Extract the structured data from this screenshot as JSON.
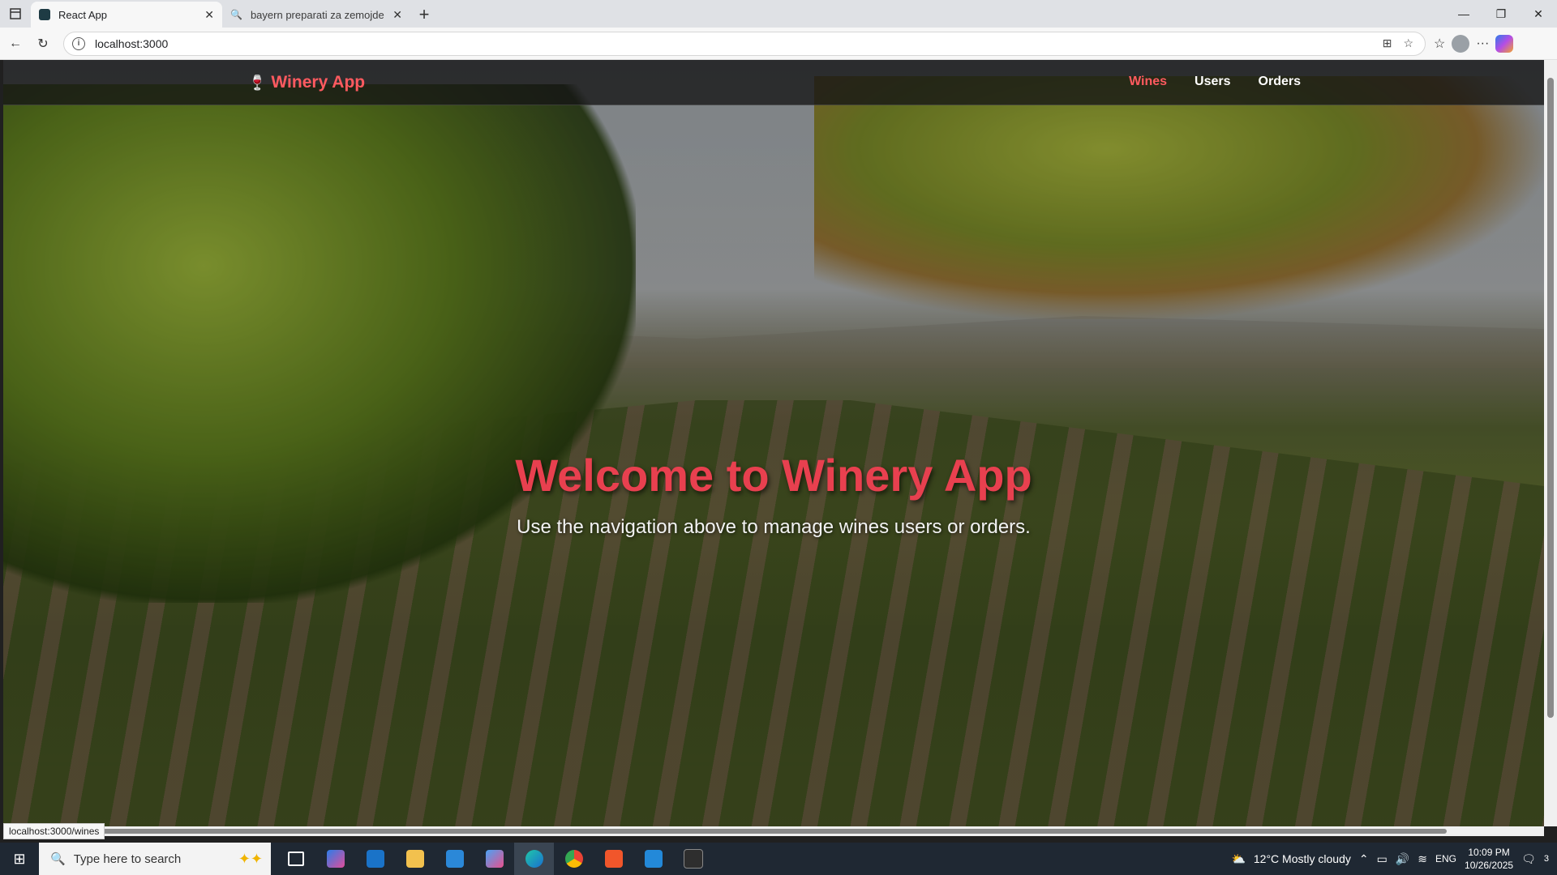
{
  "browser": {
    "tabs": [
      {
        "title": "React App",
        "active": true
      },
      {
        "title": "bayern preparati za zemojdelstvo",
        "active": false
      }
    ],
    "url": "localhost:3000",
    "status_url": "localhost:3000/wines"
  },
  "app": {
    "brand": "Winery App",
    "brand_icon": "wine-glass-icon",
    "nav": [
      {
        "label": "Wines",
        "active": true
      },
      {
        "label": "Users",
        "active": false
      },
      {
        "label": "Orders",
        "active": false
      }
    ],
    "hero_title": "Welcome to Winery App",
    "hero_subtitle": "Use the navigation above to manage wines users or orders.",
    "accent_color": "#ff5a5f"
  },
  "taskbar": {
    "search_placeholder": "Type here to search",
    "weather": "12°C  Mostly cloudy",
    "language": "ENG",
    "time": "10:09 PM",
    "date": "10/26/2025",
    "notifications": "3"
  }
}
